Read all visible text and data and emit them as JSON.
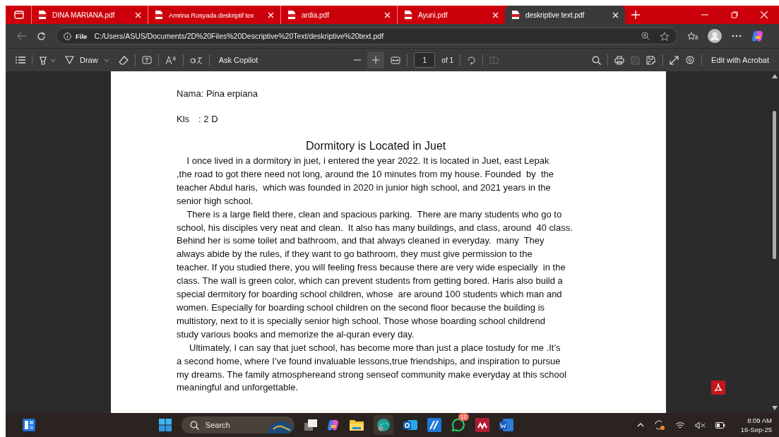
{
  "tabs": [
    {
      "label": "DINA MARIANA.pdf",
      "selected": false
    },
    {
      "label": "Amrina Rosyada deskriptif tex",
      "selected": false
    },
    {
      "label": "ardia.pdf",
      "selected": false
    },
    {
      "label": "Ayuni.pdf",
      "selected": false
    },
    {
      "label": "deskriptive text.pdf",
      "selected": true
    }
  ],
  "address": {
    "scheme": "File",
    "url": "C:/Users/ASUS/Documents/2D%20Files%20Descriptive%20Text/deskriptive%20text.pdf"
  },
  "toolbar": {
    "draw": "Draw",
    "copilot": "Ask Copilot",
    "page": "1",
    "of": "of 1",
    "acrobat": "Edit with Acrobat"
  },
  "document": {
    "name": "Nama: Pina erpiana",
    "class_label": "Kls",
    "class_value": ": 2 D",
    "title": "Dormitory is Located  in Juet",
    "paragraphs": [
      [
        "    I once lived in a dormitory in juet, i entered the year 2022. It is located in Juet, east Lepak",
        ",the road to got there need not long, around the 10 minutes from my house. Founded  by  the",
        "teacher Abdul haris,  which was founded in 2020 in junior high school, and 2021 years in the",
        "senior high school."
      ],
      [
        "    There is a large field there, clean and spacious parking.  There are many students who go to",
        "school, his disciples very neat and clean.  It also has many buildings, and class, around  40 class.",
        "Behind her is some toilet and bathroom, and that always cleaned in everyday.  many  They",
        "always abide by the rules, if they want to go bathroom, they must give permission to the",
        "teacher. If you studied there, you will feeling fress because there are very wide especially  in the",
        "class. The wall is green color, which can prevent students from getting bored. Haris also build a",
        "special dermitory for boarding school children, whose  are around 100 students which man and",
        "women. Especially for boarding school children on the second floor because the building is",
        "multistory, next to it is specially senior high school. Those whose boarding school childrend",
        "study various books and memorize the al-quran every day."
      ],
      [
        "     Ultimately, I can say that juet school, has become more than just a place tostudy for me .It’s",
        "a second home, where I’ve found invaluable lessons,true friendships, and inspiration to pursue",
        "my dreams. The family atmosphereand strong senseof community make everyday at this school",
        "meaningful and unforgettable."
      ]
    ]
  },
  "taskbar": {
    "search": "Search",
    "whatsapp_badge": "12",
    "time": "8:09 AM",
    "date": "16-Sep-25"
  }
}
